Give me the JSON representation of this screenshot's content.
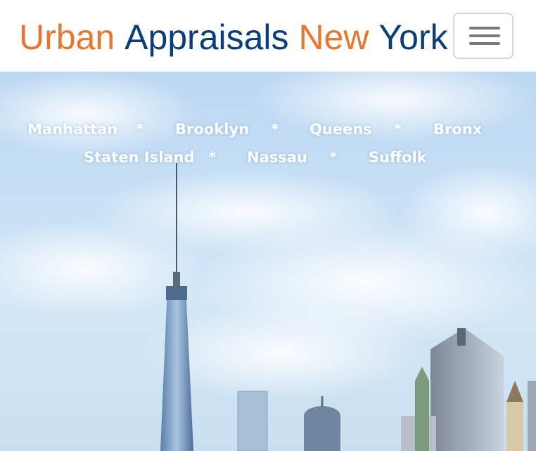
{
  "brand": {
    "word1": "Urban",
    "word2": "Appraisals",
    "word3": "New",
    "word4": "York"
  },
  "colors": {
    "accent_orange": "#e8762d",
    "brand_navy": "#0b3d78"
  },
  "nav": {
    "toggler_icon": "hamburger-menu-icon"
  },
  "areas": {
    "row1": [
      "Manhattan",
      "Brooklyn",
      "Queens",
      "Bronx"
    ],
    "row2": [
      "Staten Island",
      "Nassau",
      "Suffolk"
    ],
    "separator": "*"
  }
}
